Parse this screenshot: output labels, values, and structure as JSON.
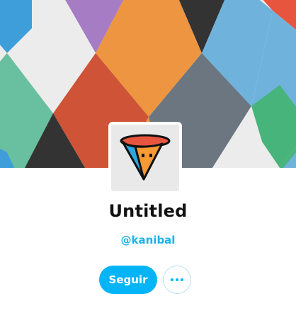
{
  "profile": {
    "title": "Untitled",
    "handle": "@kanibal"
  },
  "actions": {
    "follow_label": "Seguir",
    "more_icon": "ellipsis-icon"
  },
  "colors": {
    "accent": "#04b4f6",
    "handle": "#1ab4e6",
    "banner_palette": [
      "#3d9ed9",
      "#a67cc4",
      "#ee9541",
      "#333333",
      "#e8553f",
      "#69c0a0",
      "#ececec",
      "#ce5337",
      "#6b7680",
      "#6fb3dc",
      "#47b47c"
    ]
  },
  "logo": {
    "icon": "cone-mascot-icon"
  }
}
